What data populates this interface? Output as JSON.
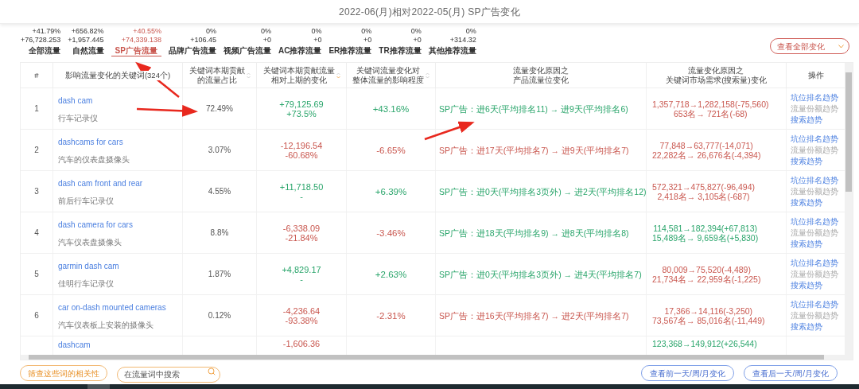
{
  "window": {
    "title": "2022-06(月)相对2022-05(月) SP广告变化"
  },
  "tabs": [
    {
      "pct": "+41.79%",
      "value": "+76,728.253",
      "label": "全部流量",
      "selected": false
    },
    {
      "pct": "+656.82%",
      "value": "+1,957.445",
      "label": "自然流量",
      "selected": false
    },
    {
      "pct": "+40.55%",
      "value": "+74,339.138",
      "label": "SP广告流量",
      "selected": true
    },
    {
      "pct": "0%",
      "value": "+106.45",
      "label": "品牌广告流量",
      "selected": false
    },
    {
      "pct": "0%",
      "value": "+0",
      "label": "视频广告流量",
      "selected": false
    },
    {
      "pct": "0%",
      "value": "+0",
      "label": "AC推荐流量",
      "selected": false
    },
    {
      "pct": "0%",
      "value": "+0",
      "label": "ER推荐流量",
      "selected": false
    },
    {
      "pct": "0%",
      "value": "+0",
      "label": "TR推荐流量",
      "selected": false
    },
    {
      "pct": "0%",
      "value": "+314.32",
      "label": "其他推荐流量",
      "selected": false
    }
  ],
  "view_dropdown": {
    "value": "查看全部变化"
  },
  "table": {
    "columns": [
      {
        "lines": [
          "#"
        ],
        "kind": "plain",
        "sorted": false
      },
      {
        "lines": [
          "影响流量变化的关键词(324个)"
        ],
        "kind": "plain",
        "sorted": false
      },
      {
        "lines": [
          "关键词本期贡献",
          "的流量占比"
        ],
        "kind": "sortable",
        "sorted": false
      },
      {
        "lines": [
          "关键词本期贡献流量",
          "相对上期的变化"
        ],
        "kind": "sortable",
        "sorted": true
      },
      {
        "lines": [
          "关键词流量变化对",
          "整体流量的影响程度"
        ],
        "kind": "sortable",
        "sorted": false
      },
      {
        "lines": [
          "流量变化原因之",
          "产品流量位变化"
        ],
        "kind": "plain",
        "sorted": false
      },
      {
        "lines": [
          "流量变化原因之",
          "关键词市场需求(搜索量)变化"
        ],
        "kind": "plain",
        "sorted": false
      },
      {
        "lines": [
          "操作"
        ],
        "kind": "plain",
        "sorted": false
      }
    ],
    "rows": [
      {
        "kind": "full",
        "index": "1",
        "keyword": "dash cam",
        "translation": "行车记录仪",
        "share": "72.49%",
        "change": {
          "lines": [
            "+79,125.69",
            "+73.5%"
          ],
          "color": "#2aa56b"
        },
        "impact": {
          "text": "+43.16%",
          "color": "#2aa56b"
        },
        "position": {
          "text": "SP广告：进6天(平均排名11) → 进9天(平均排名6)",
          "color": "#2aa56b"
        },
        "demand": {
          "lines": [
            "1,357,718→1,282,158(-75,560)",
            "653名→ 721名(-68)"
          ],
          "color": "#c9574f"
        },
        "actions": [
          {
            "label": "坑位排名趋势",
            "disabled": false
          },
          {
            "label": "流量份额趋势",
            "disabled": true
          },
          {
            "label": "搜索趋势",
            "disabled": false
          }
        ]
      },
      {
        "kind": "full",
        "index": "2",
        "keyword": "dashcams for cars",
        "translation": "汽车的仪表盘摄像头",
        "share": "3.07%",
        "change": {
          "lines": [
            "-12,196.54",
            "-60.68%"
          ],
          "color": "#c9574f"
        },
        "impact": {
          "text": "-6.65%",
          "color": "#c9574f"
        },
        "position": {
          "text": "SP广告：进17天(平均排名7) → 进9天(平均排名7)",
          "color": "#c9574f"
        },
        "demand": {
          "lines": [
            "77,848→63,777(-14,071)",
            "22,282名→ 26,676名(-4,394)"
          ],
          "color": "#c9574f"
        },
        "actions": [
          {
            "label": "坑位排名趋势",
            "disabled": false
          },
          {
            "label": "流量份额趋势",
            "disabled": true
          },
          {
            "label": "搜索趋势",
            "disabled": false
          }
        ]
      },
      {
        "kind": "full",
        "index": "3",
        "keyword": "dash cam front and rear",
        "translation": "前后行车记录仪",
        "share": "4.55%",
        "change": {
          "lines": [
            "+11,718.50",
            "-"
          ],
          "color": "#2aa56b"
        },
        "impact": {
          "text": "+6.39%",
          "color": "#2aa56b"
        },
        "position": {
          "text": "SP广告：进0天(平均排名3页外) → 进2天(平均排名12)",
          "color": "#2aa56b"
        },
        "demand": {
          "lines": [
            "572,321→475,827(-96,494)",
            "2,418名→ 3,105名(-687)"
          ],
          "color": "#c9574f"
        },
        "actions": [
          {
            "label": "坑位排名趋势",
            "disabled": false
          },
          {
            "label": "流量份额趋势",
            "disabled": true
          },
          {
            "label": "搜索趋势",
            "disabled": false
          }
        ]
      },
      {
        "kind": "full",
        "index": "4",
        "keyword": "dash camera for cars",
        "translation": "汽车仪表盘摄像头",
        "share": "8.8%",
        "change": {
          "lines": [
            "-6,338.09",
            "-21.84%"
          ],
          "color": "#c9574f"
        },
        "impact": {
          "text": "-3.46%",
          "color": "#c9574f"
        },
        "position": {
          "text": "SP广告：进18天(平均排名9) → 进8天(平均排名8)",
          "color": "#2aa56b"
        },
        "demand": {
          "lines": [
            "114,581→182,394(+67,813)",
            "15,489名→ 9,659名(+5,830)"
          ],
          "color": "#2aa56b"
        },
        "actions": [
          {
            "label": "坑位排名趋势",
            "disabled": false
          },
          {
            "label": "流量份额趋势",
            "disabled": true
          },
          {
            "label": "搜索趋势",
            "disabled": false
          }
        ]
      },
      {
        "kind": "full",
        "index": "5",
        "keyword": "garmin dash cam",
        "translation": "佳明行车记录仪",
        "share": "1.87%",
        "change": {
          "lines": [
            "+4,829.17",
            "-"
          ],
          "color": "#2aa56b"
        },
        "impact": {
          "text": "+2.63%",
          "color": "#2aa56b"
        },
        "position": {
          "text": "SP广告：进0天(平均排名3页外) → 进4天(平均排名7)",
          "color": "#2aa56b"
        },
        "demand": {
          "lines": [
            "80,009→75,520(-4,489)",
            "21,734名→ 22,959名(-1,225)"
          ],
          "color": "#c9574f"
        },
        "actions": [
          {
            "label": "坑位排名趋势",
            "disabled": false
          },
          {
            "label": "流量份额趋势",
            "disabled": true
          },
          {
            "label": "搜索趋势",
            "disabled": false
          }
        ]
      },
      {
        "kind": "full",
        "index": "6",
        "keyword": "car on-dash mounted cameras",
        "translation": "汽车仪表板上安装的摄像头",
        "share": "0.12%",
        "change": {
          "lines": [
            "-4,236.64",
            "-93.38%"
          ],
          "color": "#c9574f"
        },
        "impact": {
          "text": "-2.31%",
          "color": "#c9574f"
        },
        "position": {
          "text": "SP广告：进16天(平均排名7) → 进2天(平均排名7)",
          "color": "#c9574f"
        },
        "demand": {
          "lines": [
            "17,366→14,116(-3,250)",
            "73,567名→ 85,016名(-11,449)"
          ],
          "color": "#c9574f"
        },
        "actions": [
          {
            "label": "坑位排名趋势",
            "disabled": false
          },
          {
            "label": "流量份额趋势",
            "disabled": true
          },
          {
            "label": "搜索趋势",
            "disabled": false
          }
        ]
      },
      {
        "kind": "partial",
        "keyword": "dashcam",
        "change": {
          "lines": [
            "-1,606.36"
          ],
          "color": "#c9574f"
        },
        "demand": {
          "lines": [
            "123,368→149,912(+26,544)"
          ],
          "color": "#2aa56b"
        }
      }
    ]
  },
  "footer": {
    "filter_button": "筛查这些词的相关性",
    "search": {
      "placeholder": "在流量词中搜索"
    },
    "buttons": [
      "查看前一天/周/月变化",
      "查看后一天/周/月变化"
    ]
  }
}
